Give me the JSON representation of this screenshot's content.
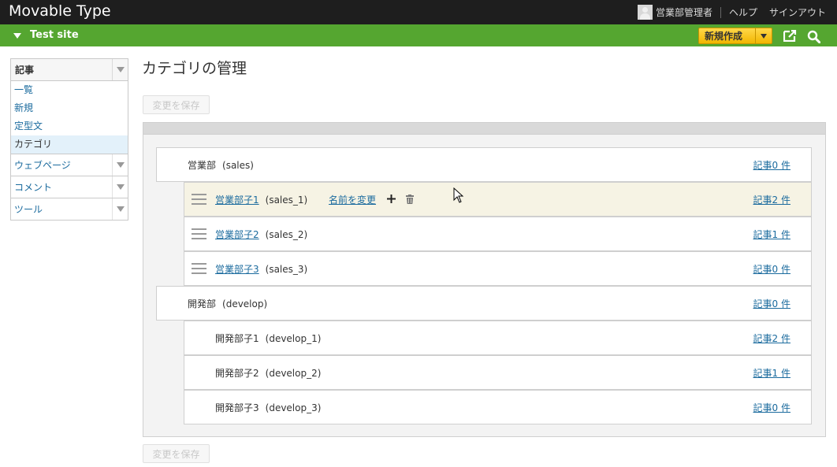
{
  "app": {
    "title": "Movable Type"
  },
  "user": {
    "name": "営業部管理者",
    "help": "ヘルプ",
    "signout": "サインアウト"
  },
  "site": {
    "name": "Test site"
  },
  "actions": {
    "new_label": "新規作成"
  },
  "sidebar": {
    "section": {
      "label": "記事"
    },
    "items": [
      {
        "label": "一覧"
      },
      {
        "label": "新規"
      },
      {
        "label": "定型文"
      },
      {
        "label": "カテゴリ"
      }
    ],
    "collapsed": [
      {
        "label": "ウェブページ"
      },
      {
        "label": "コメント"
      },
      {
        "label": "ツール"
      }
    ]
  },
  "main": {
    "title": "カテゴリの管理",
    "save_label": "変更を保存",
    "rename_label": "名前を変更",
    "categories": [
      {
        "name": "営業部",
        "basename": "(sales)",
        "count": "記事0 件",
        "linked": false
      },
      {
        "name": "営業部子1",
        "basename": "(sales_1)",
        "count": "記事2 件",
        "linked": true
      },
      {
        "name": "営業部子2",
        "basename": "(sales_2)",
        "count": "記事1 件",
        "linked": true
      },
      {
        "name": "営業部子3",
        "basename": "(sales_3)",
        "count": "記事0 件",
        "linked": true
      },
      {
        "name": "開発部",
        "basename": "(develop)",
        "count": "記事0 件",
        "linked": false
      },
      {
        "name": "開発部子1",
        "basename": "(develop_1)",
        "count": "記事2 件",
        "linked": false
      },
      {
        "name": "開発部子2",
        "basename": "(develop_2)",
        "count": "記事1 件",
        "linked": false
      },
      {
        "name": "開発部子3",
        "basename": "(develop_3)",
        "count": "記事0 件",
        "linked": false
      }
    ]
  },
  "colors": {
    "topbar": "#1e1e1e",
    "sitebar": "#55a630",
    "accent": "#f2b600",
    "link": "#1b6b9e",
    "highlight": "#f6f3e4"
  }
}
